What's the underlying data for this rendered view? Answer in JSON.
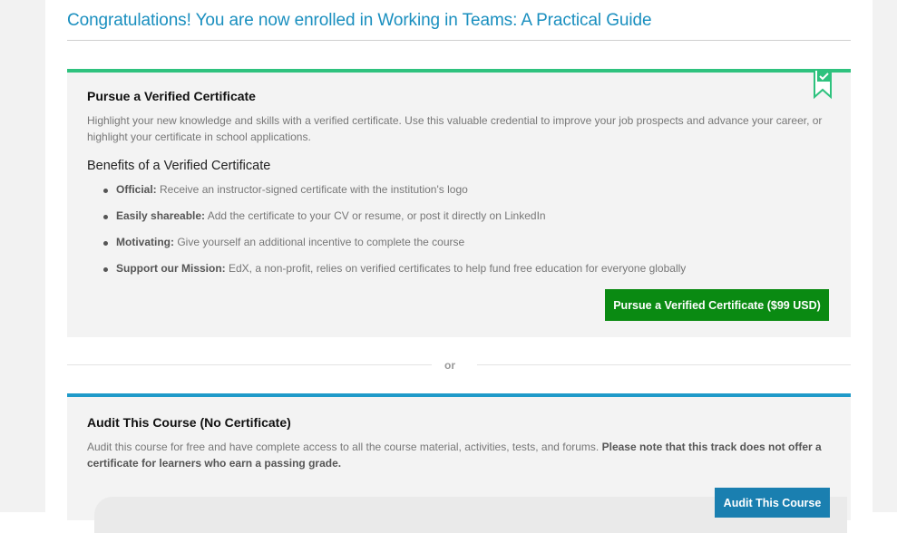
{
  "header": {
    "congrats": "Congratulations! You are now enrolled in Working in Teams: A Practical Guide"
  },
  "verified": {
    "title": "Pursue a Verified Certificate",
    "description": "Highlight your new knowledge and skills with a verified certificate. Use this valuable credential to improve your job prospects and advance your career, or highlight your certificate in school applications.",
    "benefits_heading": "Benefits of a Verified Certificate",
    "benefits": [
      {
        "title": "Official:",
        "text": " Receive an instructor-signed certificate with the institution's logo"
      },
      {
        "title": "Easily shareable:",
        "text": " Add the certificate to your CV or resume, or post it directly on LinkedIn"
      },
      {
        "title": "Motivating:",
        "text": " Give yourself an additional incentive to complete the course"
      },
      {
        "title": "Support our Mission:",
        "text": " EdX, a non-profit, relies on verified certificates to help fund free education for everyone globally"
      }
    ],
    "button_label": "Pursue a Verified Certificate ($99 USD)",
    "accent_color": "#2ec27e",
    "bookmark_icon": "verified-bookmark-icon"
  },
  "divider": {
    "label": "or"
  },
  "audit": {
    "title": "Audit This Course (No Certificate)",
    "description": "Audit this course for free and have complete access to all the course material, activities, tests, and forums. ",
    "note": "Please note that this track does not offer a certificate for learners who earn a passing grade.",
    "button_label": "Audit This Course",
    "accent_color": "#1f9ac9"
  },
  "colors": {
    "verified_button": "#0a8a12",
    "audit_button": "#1a7fb0",
    "link_blue": "#1a8fbf"
  }
}
